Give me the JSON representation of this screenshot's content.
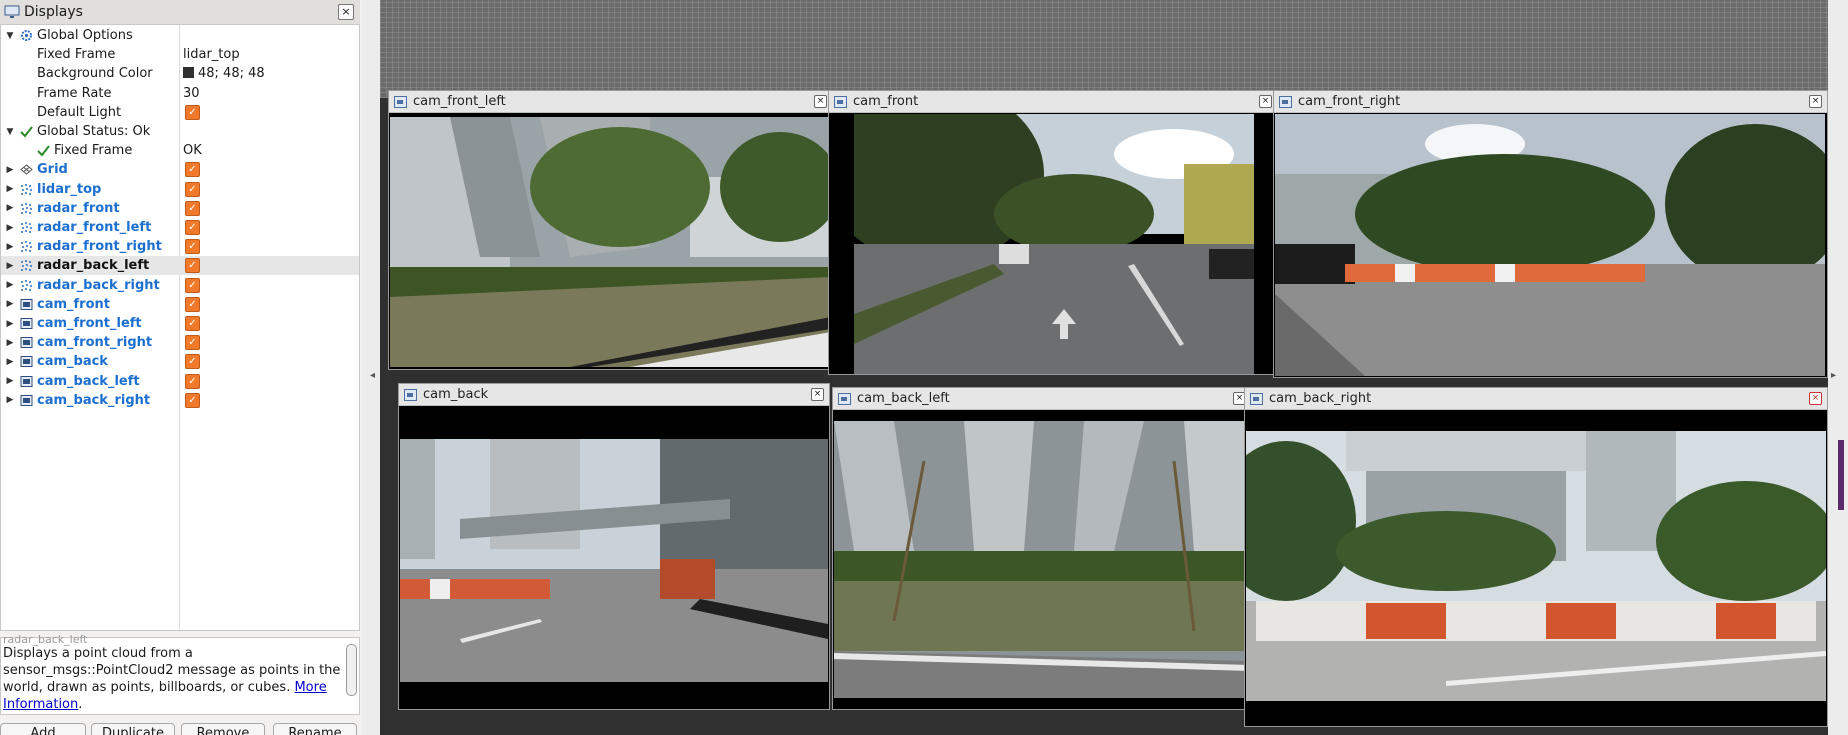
{
  "panel": {
    "title": "Displays",
    "close_glyph": "×",
    "rows": [
      {
        "name": "Global Options",
        "expand": "▼",
        "icon": "gear-icon",
        "indent": 0,
        "kind": "group"
      },
      {
        "name": "Fixed Frame",
        "value": "lidar_top",
        "indent": 1,
        "kind": "prop"
      },
      {
        "name": "Background Color",
        "value": "48; 48; 48",
        "indent": 1,
        "kind": "prop",
        "swatch": "#303030"
      },
      {
        "name": "Frame Rate",
        "value": "30",
        "indent": 1,
        "kind": "prop"
      },
      {
        "name": "Default Light",
        "indent": 1,
        "kind": "prop",
        "checked": true
      },
      {
        "name": "Global Status: Ok",
        "expand": "▼",
        "icon": "check-icon",
        "indent": 0,
        "kind": "group"
      },
      {
        "name": "Fixed Frame",
        "value": "OK",
        "indent": 1,
        "kind": "status",
        "icon": "check-icon"
      },
      {
        "name": "Grid",
        "expand": "▶",
        "icon": "grid-icon",
        "indent": 0,
        "kind": "display",
        "checked": true
      },
      {
        "name": "lidar_top",
        "expand": "▶",
        "icon": "pointcloud-icon",
        "indent": 0,
        "kind": "display",
        "checked": true
      },
      {
        "name": "radar_front",
        "expand": "▶",
        "icon": "pointcloud-icon",
        "indent": 0,
        "kind": "display",
        "checked": true
      },
      {
        "name": "radar_front_left",
        "expand": "▶",
        "icon": "pointcloud-icon",
        "indent": 0,
        "kind": "display",
        "checked": true
      },
      {
        "name": "radar_front_right",
        "expand": "▶",
        "icon": "pointcloud-icon",
        "indent": 0,
        "kind": "display",
        "checked": true
      },
      {
        "name": "radar_back_left",
        "expand": "▶",
        "icon": "pointcloud-icon",
        "indent": 0,
        "kind": "display",
        "checked": true,
        "selected": true
      },
      {
        "name": "radar_back_right",
        "expand": "▶",
        "icon": "pointcloud-icon",
        "indent": 0,
        "kind": "display",
        "checked": true
      },
      {
        "name": "cam_front",
        "expand": "▶",
        "icon": "camera-icon",
        "indent": 0,
        "kind": "display",
        "checked": true
      },
      {
        "name": "cam_front_left",
        "expand": "▶",
        "icon": "camera-icon",
        "indent": 0,
        "kind": "display",
        "checked": true
      },
      {
        "name": "cam_front_right",
        "expand": "▶",
        "icon": "camera-icon",
        "indent": 0,
        "kind": "display",
        "checked": true
      },
      {
        "name": "cam_back",
        "expand": "▶",
        "icon": "camera-icon",
        "indent": 0,
        "kind": "display",
        "checked": true
      },
      {
        "name": "cam_back_left",
        "expand": "▶",
        "icon": "camera-icon",
        "indent": 0,
        "kind": "display",
        "checked": true
      },
      {
        "name": "cam_back_right",
        "expand": "▶",
        "icon": "camera-icon",
        "indent": 0,
        "kind": "display",
        "checked": true
      }
    ],
    "description": {
      "cut_title": "radar_back_left",
      "text": "Displays a point cloud from a sensor_msgs::PointCloud2 message as points in the world, drawn as points, billboards, or cubes. ",
      "link": "More Information",
      "link_suffix": "."
    },
    "buttons": [
      "Add",
      "Duplicate",
      "Remove",
      "Rename"
    ]
  },
  "cameras": [
    {
      "title": "cam_front_left",
      "scene": "building-trees"
    },
    {
      "title": "cam_front",
      "scene": "road-ahead"
    },
    {
      "title": "cam_front_right",
      "scene": "building-barriers"
    },
    {
      "title": "cam_back",
      "scene": "road-bridge"
    },
    {
      "title": "cam_back_left",
      "scene": "building-pillars"
    },
    {
      "title": "cam_back_right",
      "scene": "barriers-building"
    }
  ],
  "colors": {
    "render_bg": "#303030",
    "accent_check": "#f07a2a",
    "display_link": "#1d6fd0"
  }
}
